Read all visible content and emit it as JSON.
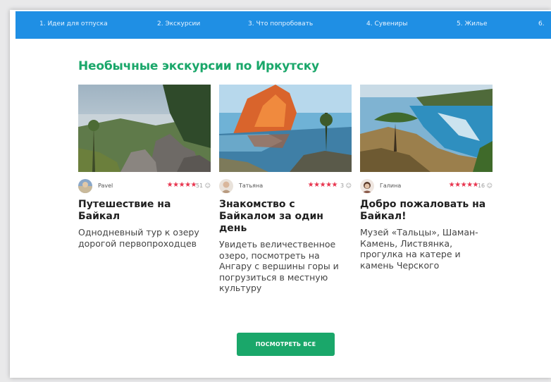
{
  "nav": {
    "items": [
      {
        "label": "1.  Идеи для отпуска"
      },
      {
        "label": "2.  Экскурсии"
      },
      {
        "label": "3.  Что попробовать"
      },
      {
        "label": "4.  Сувениры"
      },
      {
        "label": "5.  Жилье"
      },
      {
        "label": "6."
      }
    ]
  },
  "section": {
    "title": "Необычные экскурсии по Иркутску"
  },
  "cards": [
    {
      "author": "Pavel",
      "stars": "★★★★★",
      "count": "51 ☺",
      "title": "Путешествие на Байкал",
      "description": "Однодневный тур к озеру дорогой первопроходцев"
    },
    {
      "author": "Татьяна",
      "stars": "★★★★★",
      "count": "3 ☺",
      "title": "Знакомство с Байкалом за один день",
      "description": "Увидеть величественное озеро, посмотреть на Ангару с вершины горы и погрузиться в местную культуру"
    },
    {
      "author": "Галина",
      "stars": "★★★★★",
      "count": "16 ☺",
      "title": "Добро пожаловать на Байкал!",
      "description": "Музей «Тальцы», Шаман-Камень, Листвянка, прогулка на катере и камень Черского"
    }
  ],
  "button": {
    "label": "ПОСМОТРЕТЬ ВСЕ"
  },
  "colors": {
    "nav_bg": "#1f8fe4",
    "accent_green": "#1aa76a",
    "star_red": "#e8344e"
  }
}
